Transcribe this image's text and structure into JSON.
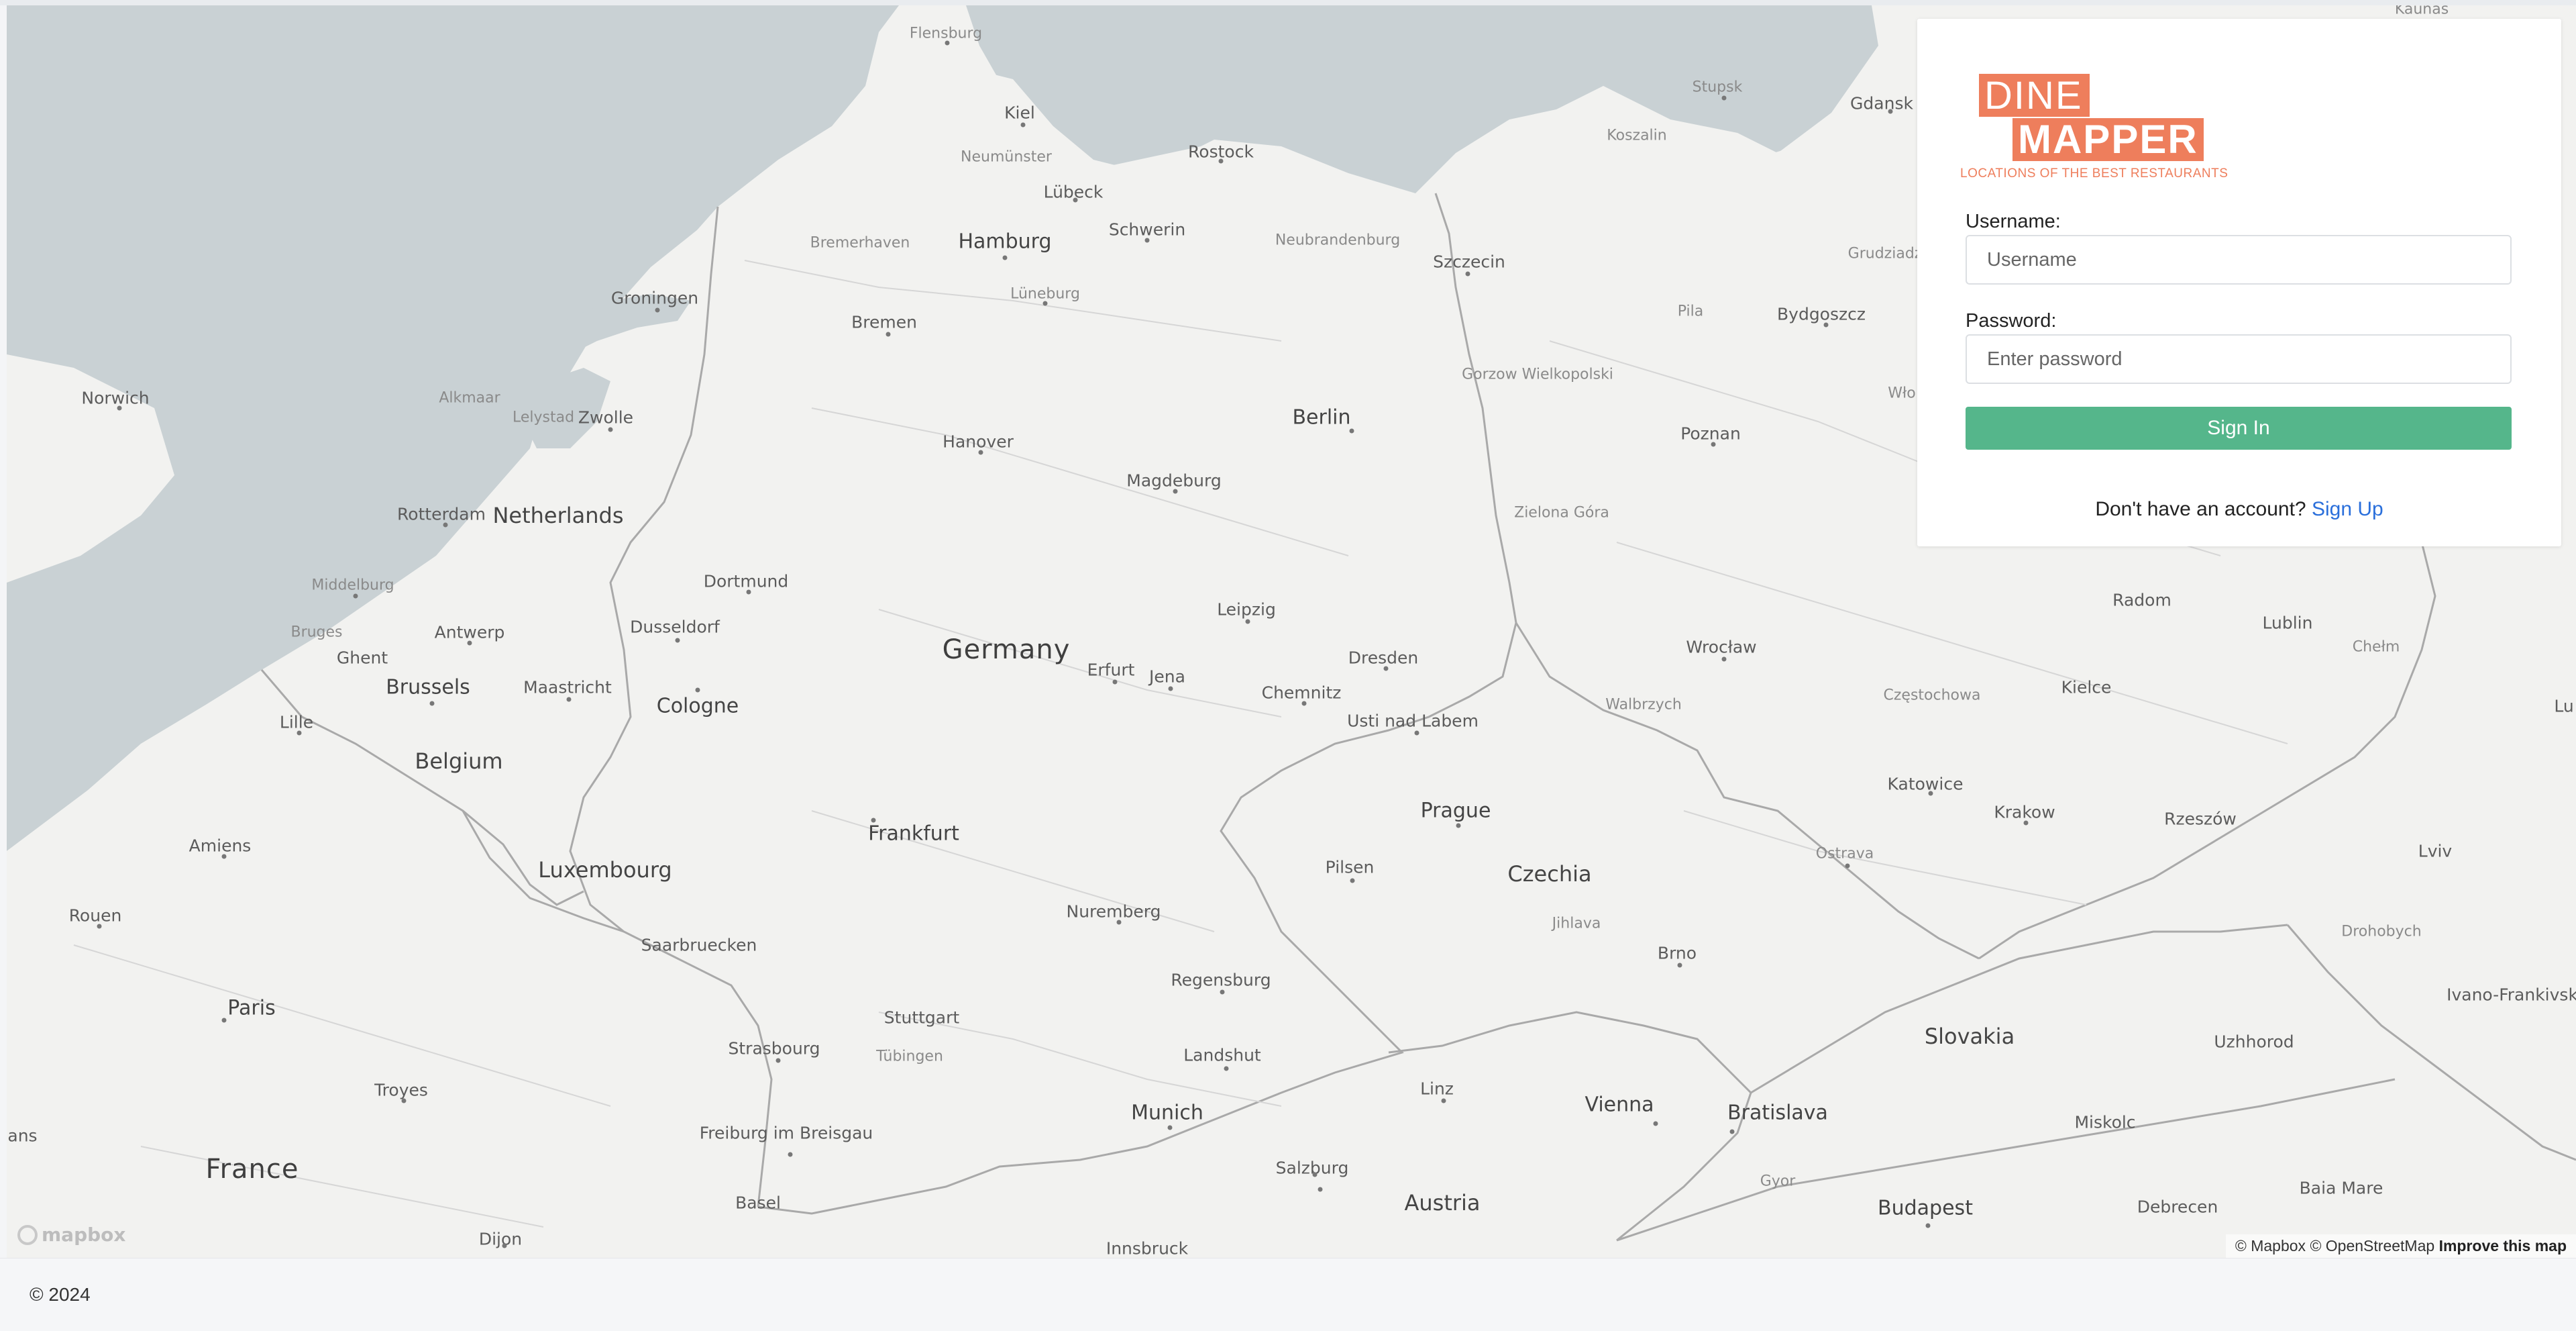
{
  "map": {
    "places": [
      {
        "name": "Flensburg",
        "size": "s"
      },
      {
        "name": "Kiel",
        "size": "m"
      },
      {
        "name": "Neumünster",
        "size": "s"
      },
      {
        "name": "Lübeck",
        "size": "m"
      },
      {
        "name": "Rostock",
        "size": "m"
      },
      {
        "name": "Stupsk",
        "size": "s"
      },
      {
        "name": "Koszalin",
        "size": "s"
      },
      {
        "name": "Gdansk",
        "size": "m"
      },
      {
        "name": "Kaunas",
        "size": "s"
      },
      {
        "name": "Bremerhaven",
        "size": "s"
      },
      {
        "name": "Hamburg",
        "size": "l"
      },
      {
        "name": "Schwerin",
        "size": "m"
      },
      {
        "name": "Neubrandenburg",
        "size": "s"
      },
      {
        "name": "Szczecin",
        "size": "m"
      },
      {
        "name": "Grudziadz",
        "size": "s"
      },
      {
        "name": "Lüneburg",
        "size": "s"
      },
      {
        "name": "Groningen",
        "size": "m"
      },
      {
        "name": "Bremen",
        "size": "m"
      },
      {
        "name": "Pila",
        "size": "s"
      },
      {
        "name": "Bydgoszcz",
        "size": "m"
      },
      {
        "name": "Norwich",
        "size": "m"
      },
      {
        "name": "Alkmaar",
        "size": "s"
      },
      {
        "name": "Lelystad",
        "size": "s"
      },
      {
        "name": "Zwolle",
        "size": "m"
      },
      {
        "name": "Gorzow Wielkopolski",
        "size": "s"
      },
      {
        "name": "Berlin",
        "size": "l"
      },
      {
        "name": "Wło",
        "size": "s"
      },
      {
        "name": "Hanover",
        "size": "m"
      },
      {
        "name": "Poznan",
        "size": "m"
      },
      {
        "name": "Magdeburg",
        "size": "m"
      },
      {
        "name": "Rotterdam",
        "size": "m"
      },
      {
        "name": "Netherlands",
        "size": "country-sm"
      },
      {
        "name": "Zielona Góra",
        "size": "s"
      },
      {
        "name": "Middelburg",
        "size": "s"
      },
      {
        "name": "Dortmund",
        "size": "m"
      },
      {
        "name": "Radom",
        "size": "m"
      },
      {
        "name": "Lublin",
        "size": "m"
      },
      {
        "name": "Bruges",
        "size": "s"
      },
      {
        "name": "Antwerp",
        "size": "m"
      },
      {
        "name": "Dusseldorf",
        "size": "m"
      },
      {
        "name": "Leipzig",
        "size": "m"
      },
      {
        "name": "Chełm",
        "size": "s"
      },
      {
        "name": "Ghent",
        "size": "m"
      },
      {
        "name": "Germany",
        "size": "country"
      },
      {
        "name": "Wrocław",
        "size": "m"
      },
      {
        "name": "Dresden",
        "size": "m"
      },
      {
        "name": "Brussels",
        "size": "l"
      },
      {
        "name": "Maastricht",
        "size": "m"
      },
      {
        "name": "Erfurt",
        "size": "m"
      },
      {
        "name": "Jena",
        "size": "m"
      },
      {
        "name": "Chemnitz",
        "size": "m"
      },
      {
        "name": "Kielce",
        "size": "m"
      },
      {
        "name": "Częstochowa",
        "size": "s"
      },
      {
        "name": "Lille",
        "size": "m"
      },
      {
        "name": "Cologne",
        "size": "l"
      },
      {
        "name": "Walbrzych",
        "size": "s"
      },
      {
        "name": "Usti nad Labem",
        "size": "m"
      },
      {
        "name": "Lu",
        "size": "m"
      },
      {
        "name": "Belgium",
        "size": "country-sm"
      },
      {
        "name": "Katowice",
        "size": "m"
      },
      {
        "name": "Frankfurt",
        "size": "l"
      },
      {
        "name": "Prague",
        "size": "l"
      },
      {
        "name": "Krakow",
        "size": "m"
      },
      {
        "name": "Rzeszów",
        "size": "m"
      },
      {
        "name": "Amiens",
        "size": "m"
      },
      {
        "name": "Luxembourg",
        "size": "country-sm"
      },
      {
        "name": "Pilsen",
        "size": "m"
      },
      {
        "name": "Ostrava",
        "size": "s"
      },
      {
        "name": "Lviv",
        "size": "m"
      },
      {
        "name": "Czechia",
        "size": "country-sm"
      },
      {
        "name": "Rouen",
        "size": "m"
      },
      {
        "name": "Nuremberg",
        "size": "m"
      },
      {
        "name": "Jihlava",
        "size": "s"
      },
      {
        "name": "Drohobych",
        "size": "s"
      },
      {
        "name": "Saarbruecken",
        "size": "m"
      },
      {
        "name": "Brno",
        "size": "m"
      },
      {
        "name": "Regensburg",
        "size": "m"
      },
      {
        "name": "Ivano-Frankivsk",
        "size": "m"
      },
      {
        "name": "Paris",
        "size": "l"
      },
      {
        "name": "Stuttgart",
        "size": "m"
      },
      {
        "name": "Slovakia",
        "size": "country-sm"
      },
      {
        "name": "Uzhhorod",
        "size": "m"
      },
      {
        "name": "Strasbourg",
        "size": "m"
      },
      {
        "name": "Tübingen",
        "size": "s"
      },
      {
        "name": "Landshut",
        "size": "m"
      },
      {
        "name": "Troyes",
        "size": "m"
      },
      {
        "name": "Linz",
        "size": "m"
      },
      {
        "name": "Vienna",
        "size": "l"
      },
      {
        "name": "Bratislava",
        "size": "l"
      },
      {
        "name": "Miskolc",
        "size": "m"
      },
      {
        "name": "Freiburg im Breisgau",
        "size": "m"
      },
      {
        "name": "Munich",
        "size": "l"
      },
      {
        "name": "lans",
        "size": "m"
      },
      {
        "name": "France",
        "size": "country"
      },
      {
        "name": "Salzburg",
        "size": "m"
      },
      {
        "name": "Gyor",
        "size": "s"
      },
      {
        "name": "Baia Mare",
        "size": "m"
      },
      {
        "name": "Basel",
        "size": "m"
      },
      {
        "name": "Austria",
        "size": "country-sm"
      },
      {
        "name": "Debrecen",
        "size": "m"
      },
      {
        "name": "Budapest",
        "size": "l"
      },
      {
        "name": "Dijon",
        "size": "m"
      },
      {
        "name": "Innsbruck",
        "size": "m"
      }
    ],
    "logo_text": "mapbox",
    "attribution": {
      "mapbox": "© Mapbox",
      "osm": "© OpenStreetMap",
      "improve": "Improve this map"
    }
  },
  "login": {
    "logo": {
      "line1": "DINE",
      "line2": "MAPPER",
      "tagline": "LOCATIONS OF THE BEST RESTAURANTS"
    },
    "username_label": "Username:",
    "username_placeholder": "Username",
    "password_label": "Password:",
    "password_placeholder": "Enter password",
    "signin_label": "Sign In",
    "signup_prompt": "Don't have an account?",
    "signup_link": "Sign Up"
  },
  "footer": {
    "copyright": "© 2024"
  },
  "colors": {
    "accent": "#55b68b",
    "brand": "#ee7e5c",
    "link": "#2a6fdb",
    "water": "#c9d1d4",
    "land": "#f2f2f0"
  }
}
